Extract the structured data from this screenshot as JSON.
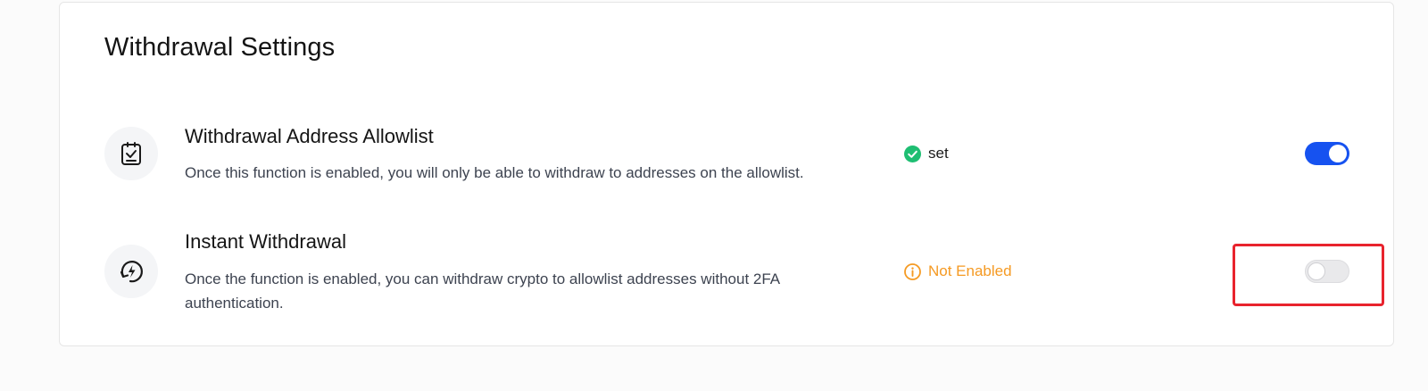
{
  "section": {
    "title": "Withdrawal Settings"
  },
  "settings": [
    {
      "icon": "clipboard-check-icon",
      "title": "Withdrawal Address Allowlist",
      "description": "Once this function is enabled, you will only be able to withdraw to addresses on the allowlist.",
      "status_label": "set",
      "status_icon": "check-circle-icon",
      "status_color": "#1ebe72",
      "enabled": true
    },
    {
      "icon": "instant-withdraw-icon",
      "title": "Instant Withdrawal",
      "description": "Once the function is enabled, you can withdraw crypto to allowlist addresses without 2FA authentication.",
      "status_label": "Not Enabled",
      "status_icon": "info-circle-icon",
      "status_color": "#f59a23",
      "enabled": false
    }
  ],
  "colors": {
    "toggle_on": "#1652f0",
    "toggle_off": "#e9e9eb",
    "highlight": "#e8232d"
  }
}
